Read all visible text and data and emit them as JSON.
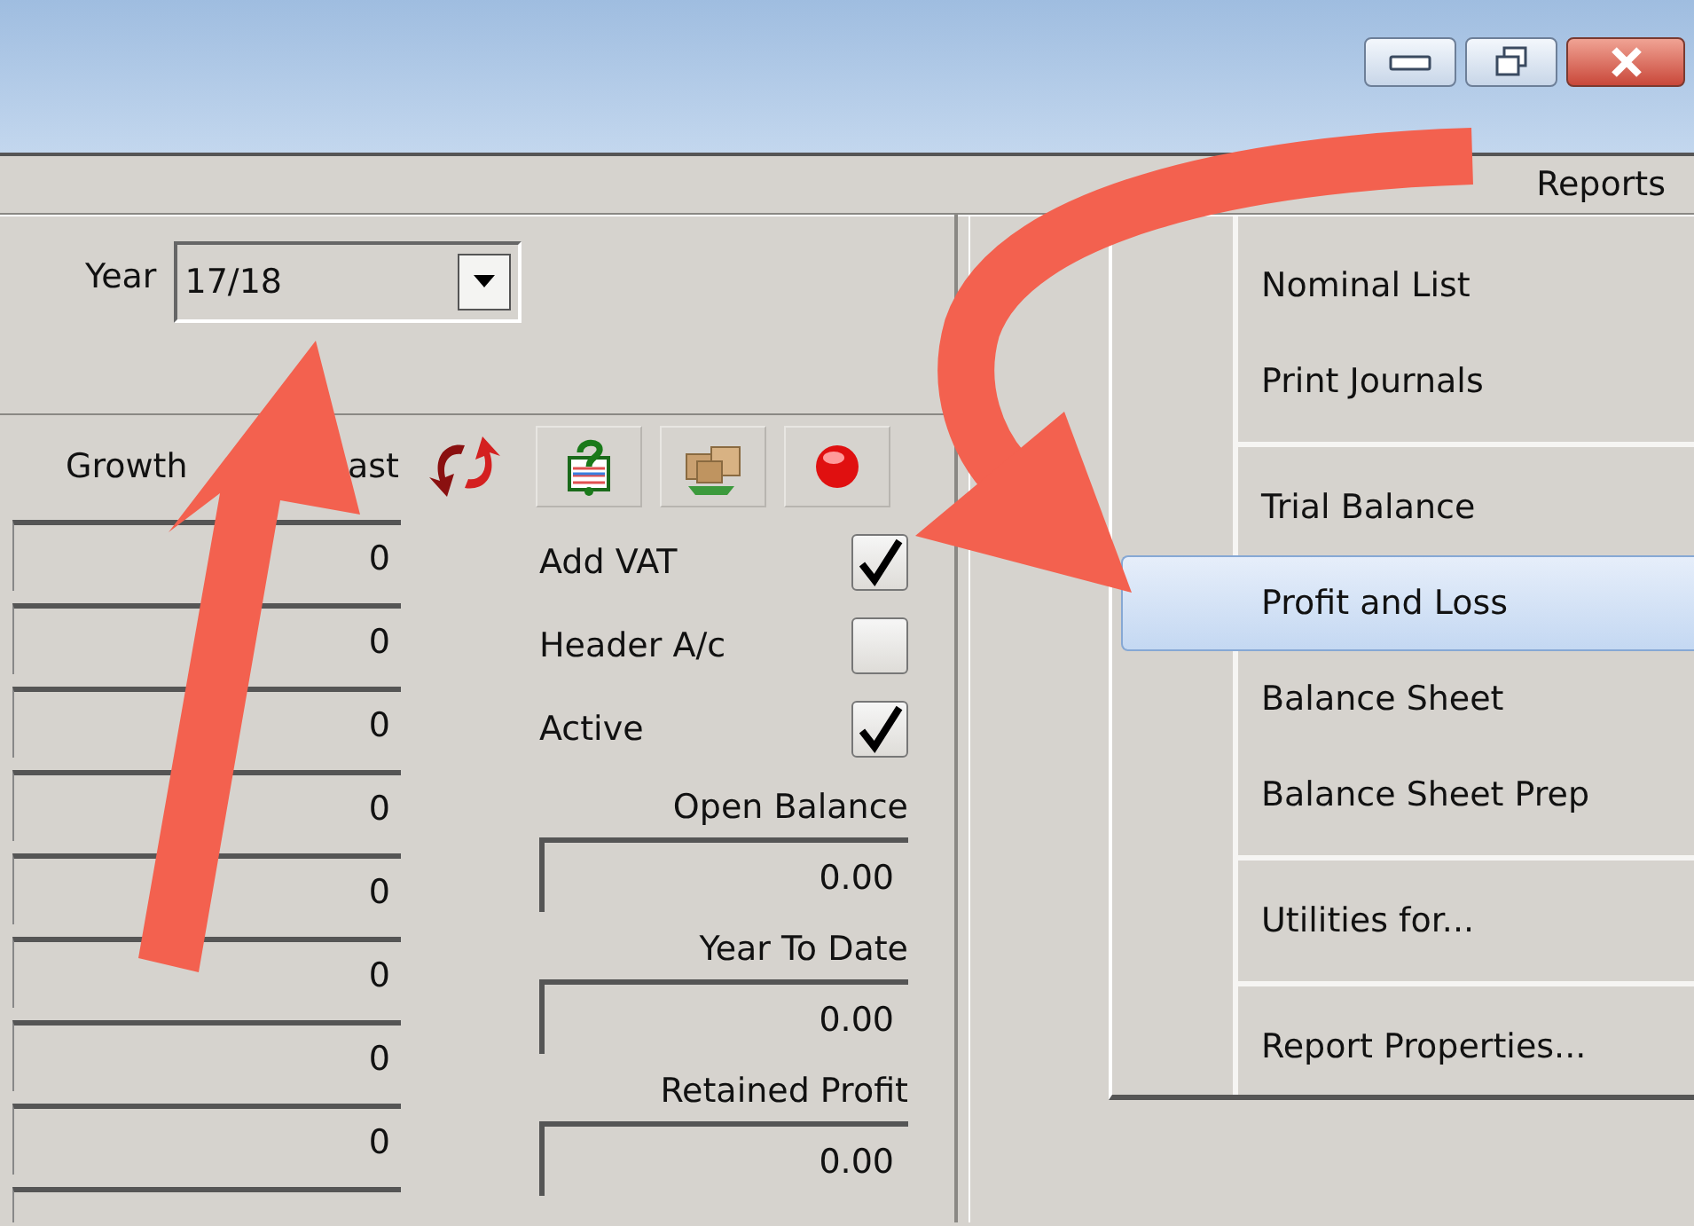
{
  "menu_bar": {
    "items": [
      {
        "label": "Reports"
      }
    ]
  },
  "toolbar": {
    "year": {
      "label": "Year",
      "value": "17/18"
    }
  },
  "forecast": {
    "header_parts": [
      "Growth",
      "ast"
    ],
    "rows": [
      "0",
      "0",
      "0",
      "0",
      "0",
      "0",
      "0",
      "0"
    ]
  },
  "flags": [
    {
      "label": "Add VAT",
      "checked": true
    },
    {
      "label": "Header A/c",
      "checked": false
    },
    {
      "label": "Active",
      "checked": true
    }
  ],
  "balances": [
    {
      "label": "Open Balance",
      "value": "0.00"
    },
    {
      "label": "Year To Date",
      "value": "0.00"
    },
    {
      "label": "Retained Profit",
      "value": "0.00"
    }
  ],
  "reports_menu": {
    "sections": [
      {
        "items": [
          {
            "label": "Nominal List",
            "selected": false
          },
          {
            "label": "Print Journals",
            "selected": false
          }
        ]
      },
      {
        "items": [
          {
            "label": "Trial Balance",
            "selected": false
          },
          {
            "label": "Profit and Loss",
            "selected": true
          },
          {
            "label": "Balance Sheet",
            "selected": false
          },
          {
            "label": "Balance Sheet Prep",
            "selected": false
          }
        ]
      },
      {
        "items": [
          {
            "label": "Utilities for...",
            "selected": false
          }
        ]
      },
      {
        "items": [
          {
            "label": "Report Properties...",
            "selected": false
          }
        ]
      }
    ]
  }
}
